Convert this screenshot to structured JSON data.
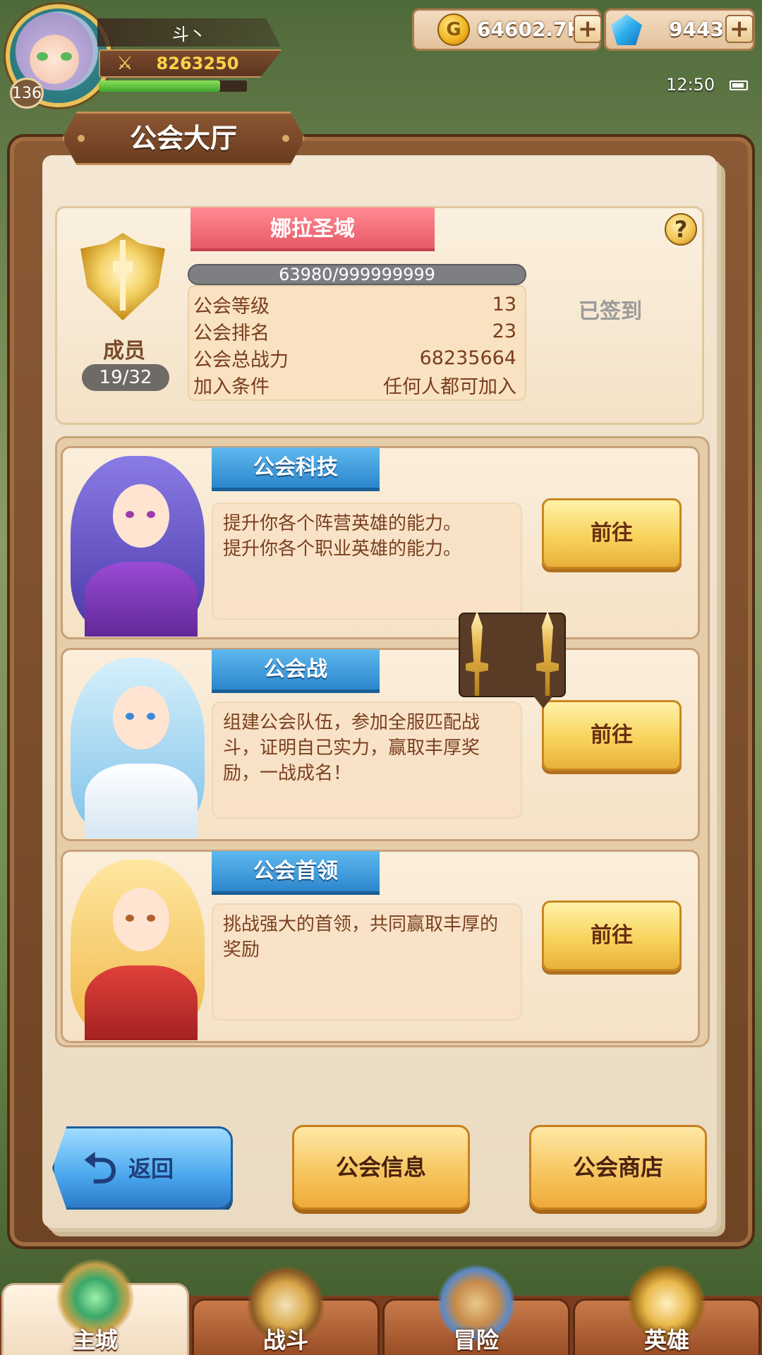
{
  "player": {
    "name": "斗丶",
    "level": "136",
    "power": "8263250",
    "exp_progress": 0.82
  },
  "resources": {
    "gold": "64602.7K",
    "gems": "9443"
  },
  "status_bar": {
    "time": "12:50"
  },
  "page": {
    "title": "公会大厅"
  },
  "guild": {
    "name": "娜拉圣域",
    "exp_text": "63980/999999999",
    "members_label": "成员",
    "members_count": "19/32",
    "signed_in_label": "已签到",
    "help_label": "?",
    "stats": [
      {
        "label": "公会等级",
        "value": "13"
      },
      {
        "label": "公会排名",
        "value": "23"
      },
      {
        "label": "公会总战力",
        "value": "68235664"
      },
      {
        "label": "加入条件",
        "value": "任何人都可加入"
      }
    ]
  },
  "features": [
    {
      "title": "公会科技",
      "description": "提升你各个阵营英雄的能力。\n提升你各个职业英雄的能力。",
      "button": "前往",
      "accent": "#7a4fd6"
    },
    {
      "title": "公会战",
      "description": "组建公会队伍，参加全服匹配战斗，证明自己实力，赢取丰厚奖励，一战成名！",
      "button": "前往",
      "accent": "#8fc9f2"
    },
    {
      "title": "公会首领",
      "description": "挑战强大的首领，共同赢取丰厚的奖励",
      "button": "前往",
      "accent": "#f2c45a"
    }
  ],
  "actions": {
    "back": "返回",
    "guild_info": "公会信息",
    "guild_shop": "公会商店"
  },
  "nav": [
    {
      "label": "主城",
      "icon": "castle-icon",
      "active": true
    },
    {
      "label": "战斗",
      "icon": "crossed-swords-icon",
      "active": false
    },
    {
      "label": "冒险",
      "icon": "map-icon",
      "active": false
    },
    {
      "label": "英雄",
      "icon": "hero-emblem-icon",
      "active": false
    }
  ],
  "colors": {
    "guild_banner": "#e65a66",
    "feature_tab": "#2c86cc",
    "go_button": "#f7d35c",
    "back_button": "#4ba8ee",
    "nav_tab": "#9a4e26"
  }
}
